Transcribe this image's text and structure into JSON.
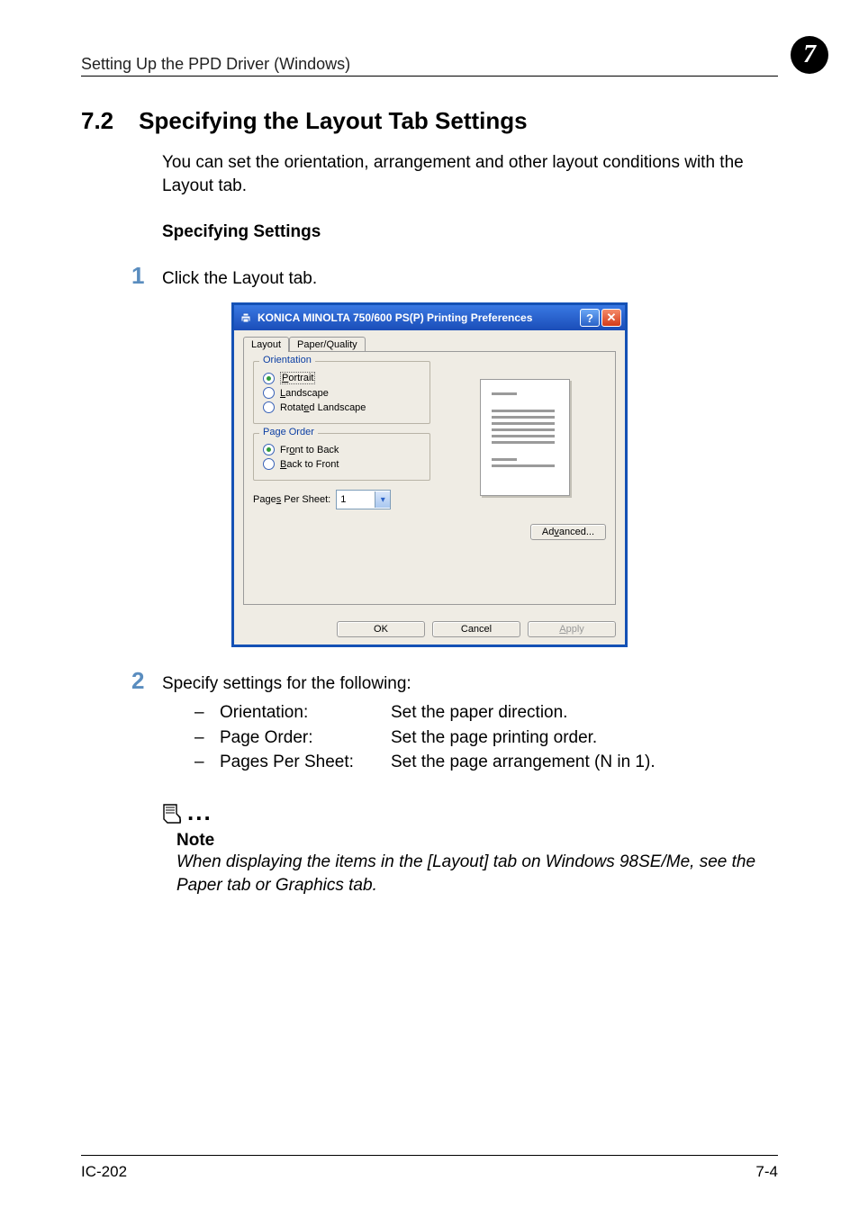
{
  "header": {
    "running_title": "Setting Up the PPD Driver (Windows)",
    "chapter_number": "7"
  },
  "section": {
    "number": "7.2",
    "title": "Specifying the Layout Tab Settings",
    "intro": "You can set the orientation, arrangement and other layout conditions with the Layout tab.",
    "subhead": "Specifying Settings"
  },
  "steps": {
    "s1": {
      "num": "1",
      "text": "Click the Layout tab."
    },
    "s2": {
      "num": "2",
      "text": "Specify settings for the following:"
    }
  },
  "settings_list": [
    {
      "label": "Orientation:",
      "desc": "Set the paper direction."
    },
    {
      "label": "Page Order:",
      "desc": "Set the page printing order."
    },
    {
      "label": "Pages Per Sheet:",
      "desc": "Set the page arrangement (N in 1)."
    }
  ],
  "dialog": {
    "title": "KONICA MINOLTA 750/600 PS(P) Printing Preferences",
    "help_symbol": "?",
    "close_symbol": "✕",
    "tabs": {
      "layout": "Layout",
      "paper_quality": "Paper/Quality"
    },
    "orientation": {
      "legend": "Orientation",
      "portrait": "Portrait",
      "landscape": "Landscape",
      "rotated": "Rotated Landscape"
    },
    "page_order": {
      "legend": "Page Order",
      "front_to_back": "Front to Back",
      "back_to_front": "Back to Front"
    },
    "pages_per_sheet": {
      "label": "Pages Per Sheet:",
      "value": "1"
    },
    "advanced": "Advanced...",
    "ok": "OK",
    "cancel": "Cancel",
    "apply": "Apply"
  },
  "note": {
    "head": "Note",
    "text": "When displaying the items in the [Layout] tab on Windows 98SE/Me, see the Paper tab or Graphics tab."
  },
  "footer": {
    "left": "IC-202",
    "right": "7-4"
  }
}
